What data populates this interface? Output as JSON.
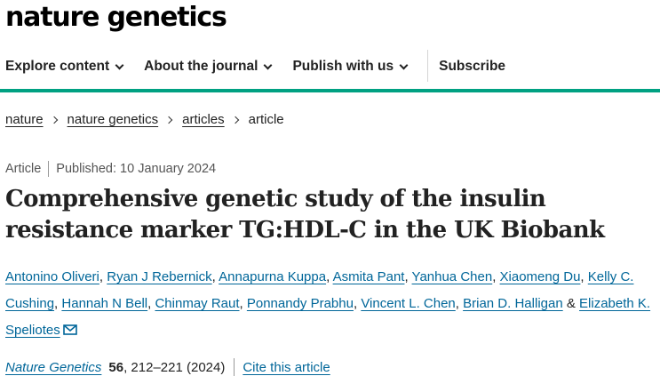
{
  "site": {
    "logo": "nature genetics"
  },
  "nav": {
    "items": [
      {
        "label": "Explore content"
      },
      {
        "label": "About the journal"
      },
      {
        "label": "Publish with us"
      }
    ],
    "subscribe": "Subscribe"
  },
  "breadcrumb": {
    "items": [
      "nature",
      "nature genetics",
      "articles"
    ],
    "current": "article"
  },
  "article": {
    "type": "Article",
    "published": "Published: 10 January 2024",
    "title": "Comprehensive genetic study of the insulin resistance marker TG:HDL-C in the UK Biobank",
    "authors": [
      "Antonino Oliveri",
      "Ryan J Rebernick",
      "Annapurna Kuppa",
      "Asmita Pant",
      "Yanhua Chen",
      "Xiaomeng Du",
      "Kelly C. Cushing",
      "Hannah N Bell",
      "Chinmay Raut",
      "Ponnandy Prabhu",
      "Vincent L. Chen",
      "Brian D. Halligan",
      "Elizabeth K. Speliotes"
    ],
    "author_separator": ",",
    "last_separator": "&",
    "contact_icon": "envelope-icon"
  },
  "citation": {
    "journal": "Nature Genetics",
    "volume": "56",
    "pages_year": ", 212–221 (2024)",
    "cite_link": "Cite this article"
  },
  "colors": {
    "accent": "#00a182",
    "link": "#006699",
    "text": "#222222"
  }
}
